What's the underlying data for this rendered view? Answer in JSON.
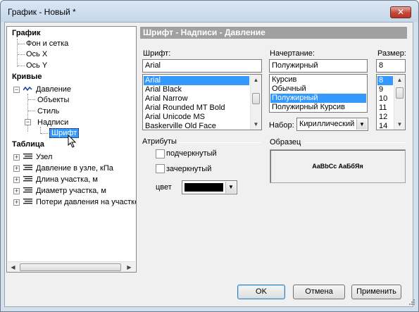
{
  "window": {
    "title": "График - Новый *",
    "close_glyph": "✕"
  },
  "tree": {
    "group_chart": "График",
    "chart_background": "Фон и сетка",
    "axis_x": "Ось X",
    "axis_y": "Ось Y",
    "group_curves": "Кривые",
    "curve_pressure": "Давление",
    "curve_objects": "Объекты",
    "curve_style": "Стиль",
    "curve_labels": "Надписи",
    "curve_font": "Шрифт",
    "group_table": "Таблица",
    "table_items": [
      "Узел",
      "Давление в узле, кПа",
      "Длина участка, м",
      "Диаметр участка, м",
      "Потери давления на участке"
    ]
  },
  "panel": {
    "header": "Шрифт - Надписи - Давление"
  },
  "font": {
    "label": "Шрифт:",
    "value": "Arial",
    "list": [
      "Arial",
      "Arial Black",
      "Arial Narrow",
      "Arial Rounded MT Bold",
      "Arial Unicode MS",
      "Baskerville Old Face"
    ],
    "selected_index": 0
  },
  "style": {
    "label": "Начертание:",
    "value": "Полужирный",
    "list": [
      "Курсив",
      "Обычный",
      "Полужирный",
      "Полужирный Курсив"
    ],
    "selected_index": 2
  },
  "size": {
    "label": "Размер:",
    "value": "8",
    "list": [
      "8",
      "9",
      "10",
      "11",
      "12",
      "14"
    ],
    "selected_index": 0
  },
  "charset": {
    "label": "Набор:",
    "value": "Кириллический"
  },
  "attributes": {
    "label": "Атрибуты",
    "underline": "подчеркнутый",
    "strikeout": "зачеркнутый",
    "color_label": "цвет",
    "color_value": "#000000"
  },
  "sample": {
    "label": "Образец",
    "text": "AaBbCc AaБбЯя"
  },
  "buttons": {
    "ok": "OK",
    "cancel": "Отмена",
    "apply": "Применить"
  },
  "icons": [
    "close-icon",
    "expand-icon",
    "collapse-icon",
    "curve-line-icon",
    "table-lines-icon",
    "mouse-pointer-icon",
    "scroll-arrow-icon",
    "dropdown-arrow-icon"
  ],
  "colors": {
    "selection": "#3399ff",
    "header_bg": "#a0a0a0"
  }
}
